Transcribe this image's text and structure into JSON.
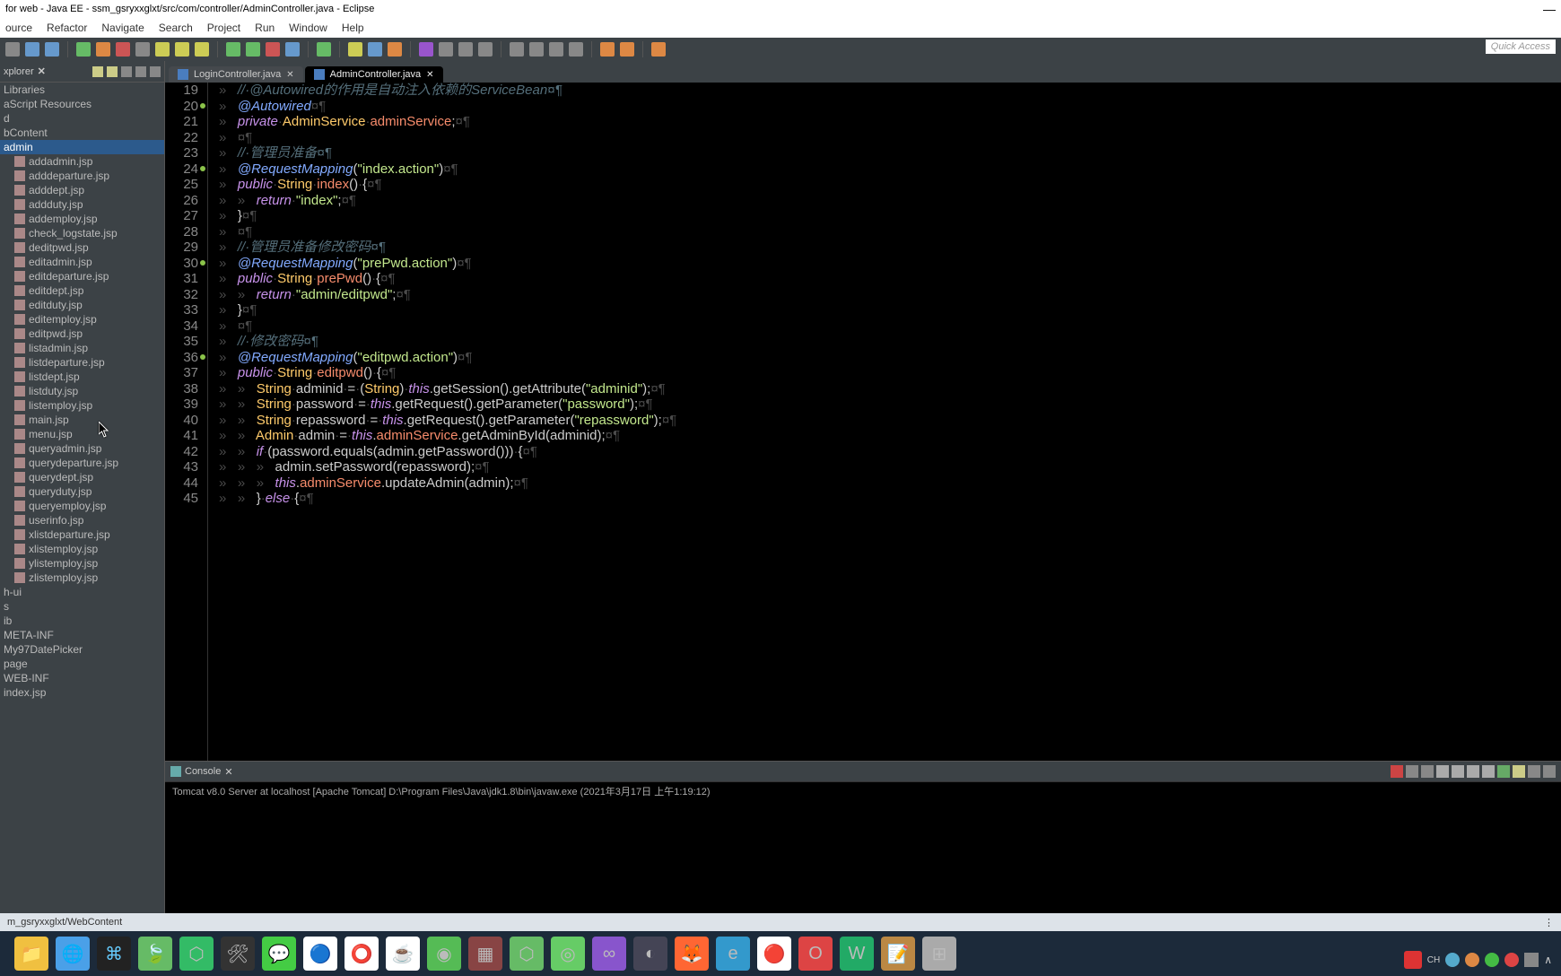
{
  "window": {
    "title": "for web - Java EE - ssm_gsryxxglxt/src/com/controller/AdminController.java - Eclipse"
  },
  "menu": [
    "ource",
    "Refactor",
    "Navigate",
    "Search",
    "Project",
    "Run",
    "Window",
    "Help"
  ],
  "quick_access": "Quick Access",
  "explorer": {
    "title": "xplorer",
    "items": [
      {
        "label": "Libraries",
        "indent": 0
      },
      {
        "label": "aScript Resources",
        "indent": 0
      },
      {
        "label": "d",
        "indent": 0
      },
      {
        "label": "bContent",
        "indent": 0
      },
      {
        "label": "admin",
        "indent": 0,
        "selected": true
      },
      {
        "label": "addadmin.jsp",
        "indent": 1
      },
      {
        "label": "adddeparture.jsp",
        "indent": 1
      },
      {
        "label": "adddept.jsp",
        "indent": 1
      },
      {
        "label": "addduty.jsp",
        "indent": 1
      },
      {
        "label": "addemploy.jsp",
        "indent": 1
      },
      {
        "label": "check_logstate.jsp",
        "indent": 1
      },
      {
        "label": "deditpwd.jsp",
        "indent": 1
      },
      {
        "label": "editadmin.jsp",
        "indent": 1
      },
      {
        "label": "editdeparture.jsp",
        "indent": 1
      },
      {
        "label": "editdept.jsp",
        "indent": 1
      },
      {
        "label": "editduty.jsp",
        "indent": 1
      },
      {
        "label": "editemploy.jsp",
        "indent": 1
      },
      {
        "label": "editpwd.jsp",
        "indent": 1
      },
      {
        "label": "listadmin.jsp",
        "indent": 1
      },
      {
        "label": "listdeparture.jsp",
        "indent": 1
      },
      {
        "label": "listdept.jsp",
        "indent": 1
      },
      {
        "label": "listduty.jsp",
        "indent": 1
      },
      {
        "label": "listemploy.jsp",
        "indent": 1
      },
      {
        "label": "main.jsp",
        "indent": 1
      },
      {
        "label": "menu.jsp",
        "indent": 1
      },
      {
        "label": "queryadmin.jsp",
        "indent": 1
      },
      {
        "label": "querydeparture.jsp",
        "indent": 1
      },
      {
        "label": "querydept.jsp",
        "indent": 1
      },
      {
        "label": "queryduty.jsp",
        "indent": 1
      },
      {
        "label": "queryemploy.jsp",
        "indent": 1
      },
      {
        "label": "userinfo.jsp",
        "indent": 1
      },
      {
        "label": "xlistdeparture.jsp",
        "indent": 1
      },
      {
        "label": "xlistemploy.jsp",
        "indent": 1
      },
      {
        "label": "ylistemploy.jsp",
        "indent": 1
      },
      {
        "label": "zlistemploy.jsp",
        "indent": 1
      },
      {
        "label": "h-ui",
        "indent": 0
      },
      {
        "label": "s",
        "indent": 0
      },
      {
        "label": "ib",
        "indent": 0
      },
      {
        "label": "META-INF",
        "indent": 0
      },
      {
        "label": "My97DatePicker",
        "indent": 0
      },
      {
        "label": "page",
        "indent": 0
      },
      {
        "label": "WEB-INF",
        "indent": 0
      },
      {
        "label": "index.jsp",
        "indent": 0
      }
    ]
  },
  "tabs": [
    {
      "label": "LoginController.java",
      "active": false
    },
    {
      "label": "AdminController.java",
      "active": true
    }
  ],
  "code": {
    "first_line": 19,
    "lines": [
      {
        "n": 19,
        "html": "<span class='ws'>»   </span><span class='com'>//·@Autowired的作用是自动注入依赖的ServiceBean¤¶</span>"
      },
      {
        "n": 20,
        "marker": true,
        "html": "<span class='ws'>»   </span><span class='ann'>@Autowired</span><span class='ws'>¤¶</span>"
      },
      {
        "n": 21,
        "html": "<span class='ws'>»   </span><span class='kw'>private</span><span class='ws'>·</span><span class='type'>AdminService</span><span class='ws'>·</span><span class='mthd'>adminService</span>;<span class='ws'>¤¶</span>"
      },
      {
        "n": 22,
        "html": "<span class='ws'>»   ¤¶</span>"
      },
      {
        "n": 23,
        "html": "<span class='ws'>»   </span><span class='com'>//·管理员准备¤¶</span>"
      },
      {
        "n": 24,
        "marker": true,
        "html": "<span class='ws'>»   </span><span class='ann'>@RequestMapping</span>(<span class='str'>\"index.action\"</span>)<span class='ws'>¤¶</span>"
      },
      {
        "n": 25,
        "html": "<span class='ws'>»   </span><span class='kw'>public</span><span class='ws'>·</span><span class='type'>String</span><span class='ws'>·</span><span class='mthd'>index</span>()<span class='ws'>·</span>{<span class='ws'>¤¶</span>"
      },
      {
        "n": 26,
        "html": "<span class='ws'>»   »   </span><span class='kw'>return</span><span class='ws'>·</span><span class='str'>\"index\"</span>;<span class='ws'>¤¶</span>"
      },
      {
        "n": 27,
        "html": "<span class='ws'>»   </span>}<span class='ws'>¤¶</span>"
      },
      {
        "n": 28,
        "html": "<span class='ws'>»   ¤¶</span>"
      },
      {
        "n": 29,
        "html": "<span class='ws'>»   </span><span class='com'>//·管理员准备修改密码¤¶</span>"
      },
      {
        "n": 30,
        "marker": true,
        "html": "<span class='ws'>»   </span><span class='ann'>@RequestMapping</span>(<span class='str'>\"prePwd.action\"</span>)<span class='ws'>¤¶</span>"
      },
      {
        "n": 31,
        "html": "<span class='ws'>»   </span><span class='kw'>public</span><span class='ws'>·</span><span class='type'>String</span><span class='ws'>·</span><span class='mthd'>prePwd</span>()<span class='ws'>·</span>{<span class='ws'>¤¶</span>"
      },
      {
        "n": 32,
        "html": "<span class='ws'>»   »   </span><span class='kw'>return</span><span class='ws'>·</span><span class='str'>\"admin/editpwd\"</span>;<span class='ws'>¤¶</span>"
      },
      {
        "n": 33,
        "html": "<span class='ws'>»   </span>}<span class='ws'>¤¶</span>"
      },
      {
        "n": 34,
        "html": "<span class='ws'>»   ¤¶</span>"
      },
      {
        "n": 35,
        "html": "<span class='ws'>»   </span><span class='com'>//·修改密码¤¶</span>"
      },
      {
        "n": 36,
        "marker": true,
        "html": "<span class='ws'>»   </span><span class='ann'>@RequestMapping</span>(<span class='str'>\"editpwd.action\"</span>)<span class='ws'>¤¶</span>"
      },
      {
        "n": 37,
        "html": "<span class='ws'>»   </span><span class='kw'>public</span><span class='ws'>·</span><span class='type'>String</span><span class='ws'>·</span><span class='mthd'>editpwd</span>()<span class='ws'>·</span>{<span class='ws'>¤¶</span>"
      },
      {
        "n": 38,
        "html": "<span class='ws'>»   »   </span><span class='type'>String</span><span class='ws'>·</span>adminid<span class='ws'>·</span>=<span class='ws'>·</span>(<span class='type'>String</span>)<span class='ws'>·</span><span class='this'>this</span>.getSession().getAttribute(<span class='str'>\"adminid\"</span>);<span class='ws'>¤¶</span>"
      },
      {
        "n": 39,
        "html": "<span class='ws'>»   »   </span><span class='type'>String</span><span class='ws'>·</span>password<span class='ws'>·</span>=<span class='ws'>·</span><span class='this'>this</span>.getRequest().getParameter(<span class='str'>\"password\"</span>);<span class='ws'>¤¶</span>"
      },
      {
        "n": 40,
        "html": "<span class='ws'>»   »   </span><span class='type'>String</span><span class='ws'>·</span>repassword<span class='ws'>·</span>=<span class='ws'>·</span><span class='this'>this</span>.getRequest().getParameter(<span class='str'>\"repassword\"</span>);<span class='ws'>¤¶</span>"
      },
      {
        "n": 41,
        "html": "<span class='ws'>»   »   </span><span class='type'>Admin</span><span class='ws'>·</span>admin<span class='ws'>·</span>=<span class='ws'>·</span><span class='this'>this</span>.<span class='mthd'>adminService</span>.getAdminById(adminid);<span class='ws'>¤¶</span>"
      },
      {
        "n": 42,
        "html": "<span class='ws'>»   »   </span><span class='kw'>if</span><span class='ws'>·</span>(password.equals(admin.getPassword()))<span class='ws'>·</span>{<span class='ws'>¤¶</span>"
      },
      {
        "n": 43,
        "html": "<span class='ws'>»   »   »   </span>admin.setPassword(repassword);<span class='ws'>¤¶</span>"
      },
      {
        "n": 44,
        "html": "<span class='ws'>»   »   »   </span><span class='this'>this</span>.<span class='mthd'>adminService</span>.updateAdmin(admin);<span class='ws'>¤¶</span>"
      },
      {
        "n": 45,
        "html": "<span class='ws'>»   »   </span>}<span class='ws'>·</span><span class='kw'>else</span><span class='ws'>·</span>{<span class='ws'>¤¶</span>"
      }
    ]
  },
  "console": {
    "title": "Console",
    "status": "Tomcat v8.0 Server at localhost [Apache Tomcat] D:\\Program Files\\Java\\jdk1.8\\bin\\javaw.exe (2021年3月17日 上午1:19:12)"
  },
  "status": {
    "path": "m_gsryxxglxt/WebContent"
  },
  "tray": {
    "ime": "CH"
  }
}
